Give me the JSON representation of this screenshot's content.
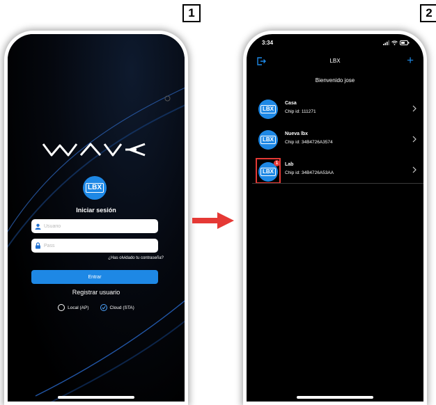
{
  "steps": {
    "first": "1",
    "second": "2"
  },
  "login": {
    "title": "Iniciar sesión",
    "username_placeholder": "Usuario",
    "password_placeholder": "Pass",
    "forgot": "¿Has olvidado tu contraseña?",
    "enter": "Entrar",
    "register": "Registrar usuario",
    "mode_local": "Local (AP)",
    "mode_cloud": "Cloud (STA)",
    "selected_mode": "Cloud (STA)"
  },
  "logo_badge": "LBX",
  "devices_screen": {
    "time": "3:34",
    "title": "LBX",
    "add_label": "+",
    "welcome": "Bienvenido jose",
    "devices": [
      {
        "name": "Casa",
        "chip": "Chip id: 111271"
      },
      {
        "name": "Nueva lbx",
        "chip": "Chip id: 34B4726A3574"
      },
      {
        "name": "Lab",
        "chip": "Chip id: 34B4726A53AA",
        "notification": "1"
      }
    ]
  },
  "colors": {
    "accent": "#1e88e5",
    "highlight": "#e53935",
    "arrow": "#e53935"
  }
}
